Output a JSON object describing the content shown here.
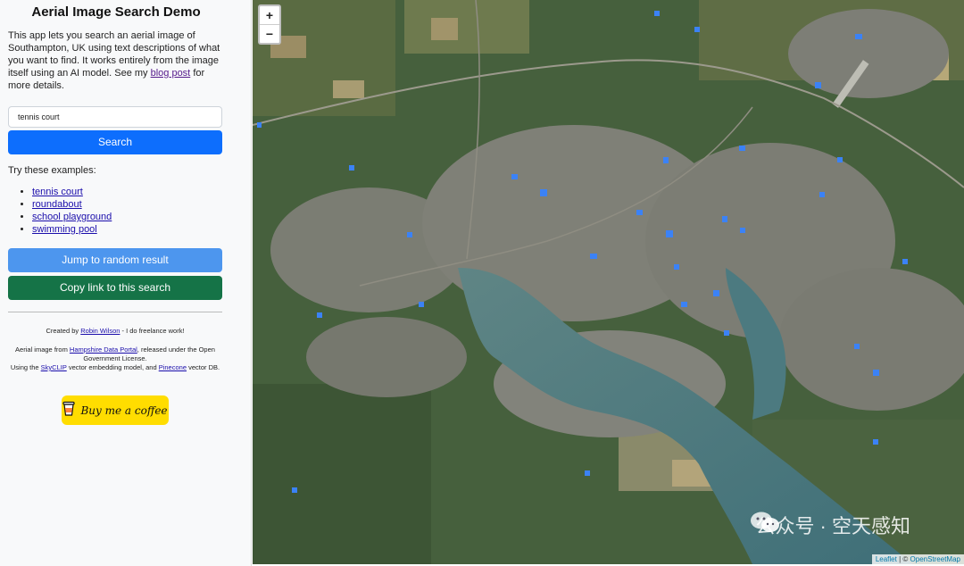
{
  "sidebar": {
    "title": "Aerial Image Search Demo",
    "intro_before": "This app lets you search an aerial image of Southampton, UK using text descriptions of what you want to find. It works entirely from the image itself using an AI model. See my",
    "intro_link": "blog post",
    "intro_after": "for more details.",
    "search_value": "tennis court",
    "search_button": "Search",
    "examples_heading": "Try these examples:",
    "examples": [
      "tennis court",
      "roundabout",
      "school playground",
      "swimming pool"
    ],
    "random_button": "Jump to random result",
    "copy_button": "Copy link to this search",
    "credit_before": "Created by",
    "credit_link": "Robin Wilson",
    "credit_after": "- I do freelance work!",
    "attrib_1": "Aerial image from",
    "attrib_link_1": "Hampshire Data Portal",
    "attrib_2": ", released under the Open Government License.",
    "attrib_3": "Using the",
    "attrib_link_2": "SkyCLIP",
    "attrib_4": "vector embedding model, and",
    "attrib_link_3": "Pinecone",
    "attrib_5": "vector DB.",
    "bmc_label": "Buy me a coffee"
  },
  "map": {
    "zoom_in": "+",
    "zoom_out": "−",
    "watermark": "公众号 · 空天感知",
    "attribution_leaflet": "Leaflet",
    "attribution_sep": "| ©",
    "attribution_osm": "OpenStreetMap",
    "marker_color": "#3b82f6"
  }
}
